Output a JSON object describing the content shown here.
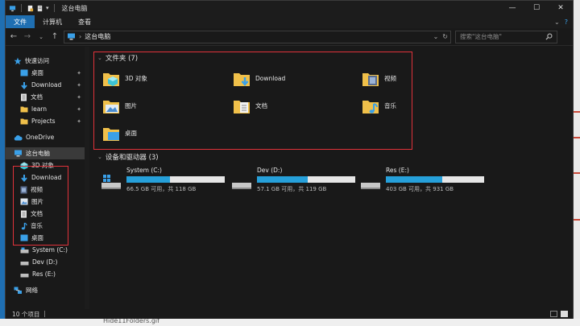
{
  "window": {
    "title": "这台电脑",
    "controls": [
      "minimize",
      "maximize",
      "close"
    ]
  },
  "ribbon": {
    "tabs": [
      "文件",
      "计算机",
      "查看"
    ],
    "active_tab": "文件"
  },
  "address": {
    "path": "这台电脑",
    "search_placeholder": "搜索\"这台电脑\""
  },
  "nav": {
    "quick_access": "快速访问",
    "quick_items": [
      {
        "label": "桌面",
        "icon": "desktop-icon",
        "pinned": true
      },
      {
        "label": "Download",
        "icon": "download-icon",
        "pinned": true
      },
      {
        "label": "文档",
        "icon": "document-icon",
        "pinned": true
      },
      {
        "label": "learn",
        "icon": "folder-icon",
        "pinned": true
      },
      {
        "label": "Projects",
        "icon": "folder-icon",
        "pinned": true
      }
    ],
    "onedrive": "OneDrive",
    "this_pc": "这台电脑",
    "pc_items": [
      {
        "label": "3D 对象",
        "icon": "3d-objects-icon"
      },
      {
        "label": "Download",
        "icon": "download-icon"
      },
      {
        "label": "视频",
        "icon": "video-icon"
      },
      {
        "label": "图片",
        "icon": "pictures-icon"
      },
      {
        "label": "文档",
        "icon": "document-icon"
      },
      {
        "label": "音乐",
        "icon": "music-icon"
      },
      {
        "label": "桌面",
        "icon": "desktop-icon"
      }
    ],
    "drives": [
      {
        "label": "System (C:)"
      },
      {
        "label": "Dev (D:)"
      },
      {
        "label": "Res (E:)"
      }
    ],
    "network": "网络"
  },
  "folders_section": {
    "title": "文件夹 (7)",
    "items": [
      {
        "label": "3D 对象",
        "icon": "3d-objects-icon"
      },
      {
        "label": "Download",
        "icon": "download-icon"
      },
      {
        "label": "视频",
        "icon": "video-icon"
      },
      {
        "label": "图片",
        "icon": "pictures-icon"
      },
      {
        "label": "文档",
        "icon": "document-icon"
      },
      {
        "label": "音乐",
        "icon": "music-icon"
      },
      {
        "label": "桌面",
        "icon": "desktop-icon"
      }
    ]
  },
  "drives_section": {
    "title": "设备和驱动器 (3)",
    "items": [
      {
        "label": "System (C:)",
        "free_text": "66.5 GB 可用，共 118 GB",
        "used_fraction": 0.44
      },
      {
        "label": "Dev (D:)",
        "free_text": "57.1 GB 可用，共 119 GB",
        "used_fraction": 0.52
      },
      {
        "label": "Res (E:)",
        "free_text": "403 GB 可用，共 931 GB",
        "used_fraction": 0.57
      }
    ]
  },
  "status": {
    "count": "10 个项目"
  },
  "background": {
    "caption": "Hide11Folders.gif"
  },
  "colors": {
    "accent": "#1f6fb2",
    "drive_bar": "#26a0da",
    "highlight_box": "#e0323a",
    "folder_yellow": "#f0c04a"
  }
}
